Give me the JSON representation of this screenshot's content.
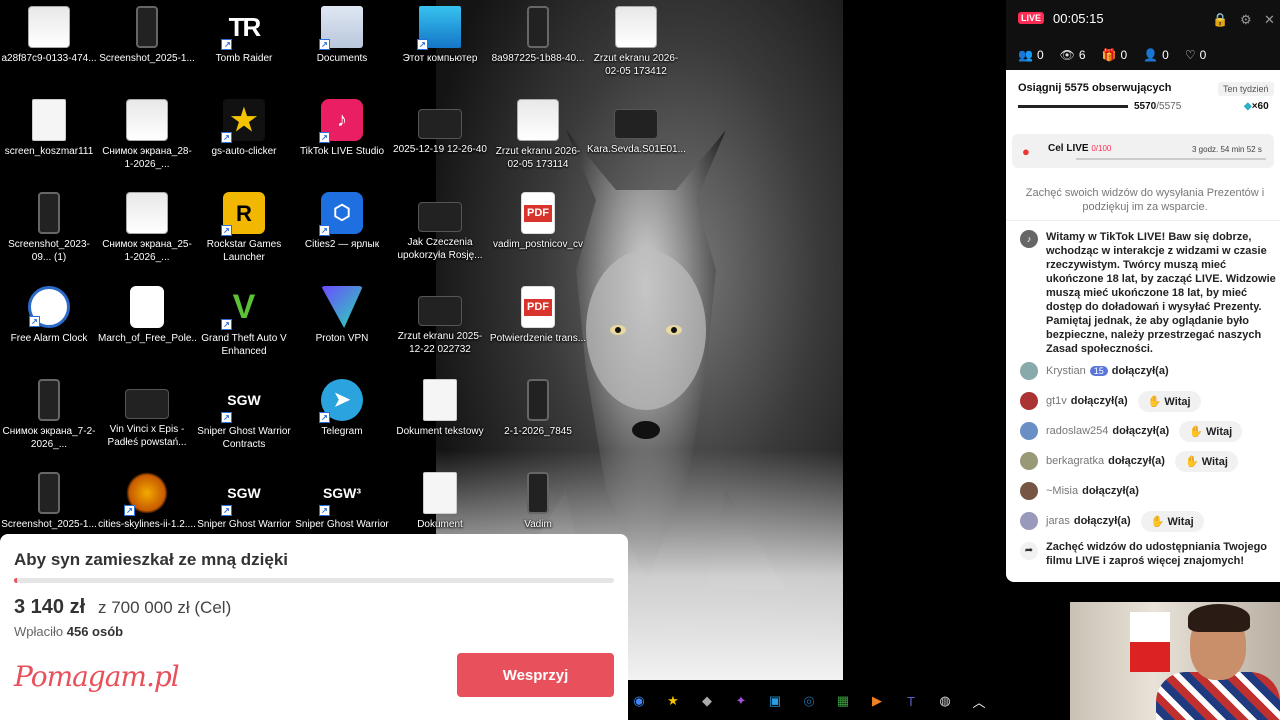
{
  "desktop": {
    "icons": [
      {
        "label": "a28f87c9-0133-474...",
        "type": "shot"
      },
      {
        "label": "Screenshot_2025-1...",
        "type": "phone"
      },
      {
        "label": "Tomb Raider",
        "type": "tr",
        "glyph": "TR"
      },
      {
        "label": "Documents",
        "type": "folder"
      },
      {
        "label": "Этот компьютер",
        "type": "pc"
      },
      {
        "label": "8a987225-1b88-40...",
        "type": "phone"
      },
      {
        "label": "Zrzut ekranu 2026-02-05 173412",
        "type": "shot"
      },
      {
        "label": "screen_koszmar111",
        "type": "doc"
      },
      {
        "label": "Снимок экрана_28-1-2026_...",
        "type": "shot"
      },
      {
        "label": "gs-auto-clicker",
        "type": "star",
        "glyph": "★"
      },
      {
        "label": "TikTok LIVE Studio",
        "type": "tiktok",
        "glyph": "♪"
      },
      {
        "label": "2025-12-19 12-26-40",
        "type": "video"
      },
      {
        "label": "Zrzut ekranu 2026-02-05 173114",
        "type": "shot"
      },
      {
        "label": "Kara.Sevda.S01E01....",
        "type": "video"
      },
      {
        "label": "Screenshot_2023-09... (1)",
        "type": "phone"
      },
      {
        "label": "Снимок экрана_25-1-2026_...",
        "type": "shot"
      },
      {
        "label": "Rockstar Games Launcher",
        "type": "rockstar",
        "glyph": "R"
      },
      {
        "label": "Cities2 — ярлык",
        "type": "cities",
        "glyph": "⬡"
      },
      {
        "label": "Jak Czeczenia upokorzyła Rosję...",
        "type": "video"
      },
      {
        "label": "vadim_postnicov_cv",
        "type": "pdf",
        "glyph": "PDF"
      },
      {
        "label": "Free Alarm Clock",
        "type": "clock"
      },
      {
        "label": "March_of_Free_Pole...",
        "type": "play",
        "glyph": "▶"
      },
      {
        "label": "Grand Theft Auto V Enhanced",
        "type": "gta",
        "glyph": "V"
      },
      {
        "label": "Proton VPN",
        "type": "proton"
      },
      {
        "label": "Zrzut ekranu 2025-12-22 022732",
        "type": "video"
      },
      {
        "label": "Potwierdzenie trans...",
        "type": "pdf",
        "glyph": "PDF"
      },
      {
        "label": "Снимок экрана_7-2-2026_...",
        "type": "phone"
      },
      {
        "label": "Vin Vinci x Epis - Padłeś powstań...",
        "type": "video"
      },
      {
        "label": "Sniper Ghost Warrior Contracts",
        "type": "sgw",
        "glyph": "SGW"
      },
      {
        "label": "Telegram",
        "type": "telegram",
        "glyph": "➤"
      },
      {
        "label": "Dokument tekstowy",
        "type": "doc"
      },
      {
        "label": "2-1-2026_7845",
        "type": "phone"
      },
      {
        "label": "Screenshot_2025-1...",
        "type": "phone"
      },
      {
        "label": "cities-skylines-ii-1.2....",
        "type": "rocket"
      },
      {
        "label": "Sniper Ghost Warrior",
        "type": "sgw",
        "glyph": "SGW"
      },
      {
        "label": "Sniper Ghost Warrior",
        "type": "sgw",
        "glyph": "SGW³"
      },
      {
        "label": "Dokument",
        "type": "doc"
      },
      {
        "label": "Vadim",
        "type": "phone"
      }
    ]
  },
  "fundraiser": {
    "title": "Aby syn zamieszkał ze mną dzięki",
    "amount": "3 140 zł",
    "goal": "z 700 000 zł (Cel)",
    "donors_prefix": "Wpłaciło",
    "donors_count": "456 osób",
    "logo": "Pomagam.pl",
    "button": "Wesprzyj",
    "progress": 0.0045,
    "accent": "#e8505b"
  },
  "live": {
    "badge": "LIVE",
    "timer": "00:05:15",
    "stats": [
      {
        "icon": "viewers-icon",
        "glyph": "👥",
        "value": "0"
      },
      {
        "icon": "eye-icon",
        "glyph": "👁",
        "value": "6"
      },
      {
        "icon": "gift-icon",
        "glyph": "🎁",
        "value": "0"
      },
      {
        "icon": "follow-icon",
        "glyph": "👤",
        "value": "0"
      },
      {
        "icon": "heart-icon",
        "glyph": "♡",
        "value": "0"
      }
    ],
    "goal": {
      "title": "Osiągnij 5575 obserwujących",
      "week": "Ten tydzień",
      "current": "5570",
      "target": "/5575",
      "multiplier": "×60",
      "progress": 0.999
    },
    "cel": {
      "label": "Cel LIVE",
      "count": "0/100",
      "time": "3 godz. 54 min 52 s"
    },
    "encourage": "Zachęć swoich widzów do wysyłania Prezentów i podziękuj im za wsparcie.",
    "welcome": "Witamy w TikTok LIVE! Baw się dobrze, wchodząc w interakcje z widzami w czasie rzeczywistym. Twórcy muszą mieć ukończone 18 lat, by zacząć LIVE. Widzowie muszą mieć ukończone 18 lat, by mieć dostęp do doładowań i wysyłać Prezenty. Pamiętaj jednak, że aby oglądanie było bezpieczne, należy przestrzegać naszych Zasad społeczności.",
    "chat": [
      {
        "user": "Krystian",
        "level": "15",
        "action": "dołączył(a)",
        "witaj": "",
        "color": "#8aa"
      },
      {
        "user": "gt1v",
        "level": "",
        "action": "dołączył(a)",
        "witaj": "Witaj",
        "color": "#a33"
      },
      {
        "user": "radoslaw254",
        "level": "",
        "action": "dołączył(a)",
        "witaj": "Witaj",
        "color": "#6a8fc7"
      },
      {
        "user": "berkagratka",
        "level": "",
        "action": "dołączył(a)",
        "witaj": "Witaj",
        "color": "#997"
      },
      {
        "user": "~Misia",
        "level": "",
        "action": "dołączył(a)",
        "witaj": "",
        "color": "#754"
      },
      {
        "user": "jaras",
        "level": "",
        "action": "dołączył(a)",
        "witaj": "Witaj",
        "color": "#99b"
      }
    ],
    "share": "Zachęć widzów do udostępniania Twojego filmu LIVE i zaproś więcej znajomych!"
  },
  "taskbar": {
    "icons": [
      {
        "name": "chrome-icon",
        "glyph": "◉",
        "color": "#4285f4"
      },
      {
        "name": "star-icon",
        "glyph": "★",
        "color": "#f5c400"
      },
      {
        "name": "box-icon",
        "glyph": "◆",
        "color": "#aaa"
      },
      {
        "name": "app-icon",
        "glyph": "✦",
        "color": "#a050d0"
      },
      {
        "name": "photos-icon",
        "glyph": "▣",
        "color": "#2a9fe0"
      },
      {
        "name": "steam-icon",
        "glyph": "◎",
        "color": "#1b6fa8"
      },
      {
        "name": "game-icon",
        "glyph": "▦",
        "color": "#3ca040"
      },
      {
        "name": "player-icon",
        "glyph": "▶",
        "color": "#f08020"
      },
      {
        "name": "teams-icon",
        "glyph": "T",
        "color": "#5b5fc7"
      },
      {
        "name": "obs-icon",
        "glyph": "◍",
        "color": "#ddd"
      },
      {
        "name": "chevron-up-icon",
        "glyph": "︿",
        "color": "#fff"
      }
    ]
  }
}
